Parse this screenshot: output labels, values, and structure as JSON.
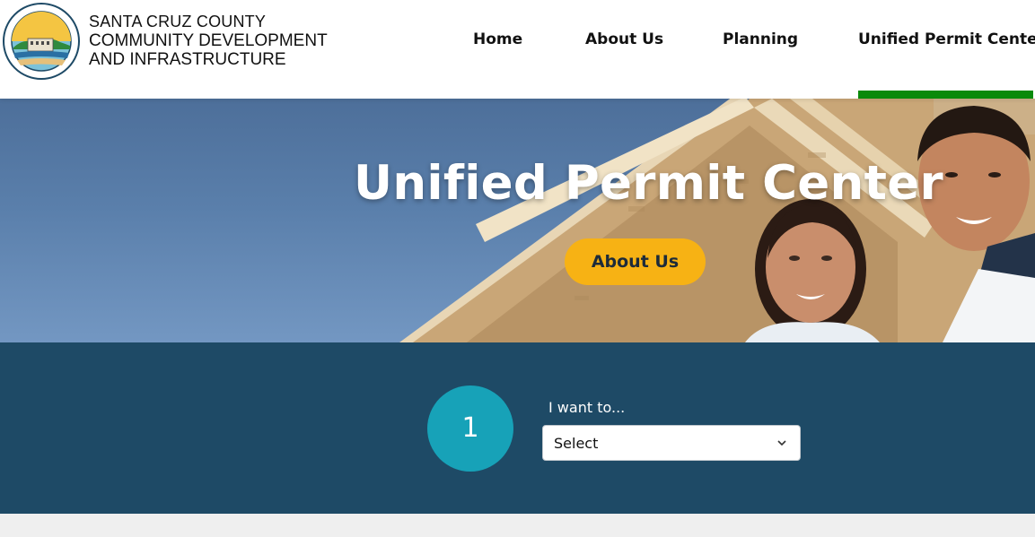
{
  "brand": {
    "line1": "SANTA CRUZ COUNTY",
    "line2": "COMMUNITY DEVELOPMENT",
    "line3": "AND INFRASTRUCTURE",
    "seal_text_top": "COMMUNITY DEVELOPMENT & INFRASTRUCTURE",
    "seal_text_bottom": "COUNTY OF SANTA CRUZ"
  },
  "nav": {
    "items": [
      "Home",
      "About Us",
      "Planning",
      "Unified Permit Center"
    ],
    "active": "Unified Permit Center"
  },
  "hero": {
    "title": "Unified Permit Center",
    "button_label": "About Us"
  },
  "finder": {
    "step_number": "1",
    "label": "I want to...",
    "select_value": "Select"
  },
  "colors": {
    "active_underline": "#0a8a0a",
    "button_yellow": "#f7b214",
    "band_navy": "#1e4a66",
    "step_teal": "#17a2b8"
  },
  "icons": {
    "logo": "county-seal-icon",
    "select_arrow": "chevron-down-icon"
  }
}
